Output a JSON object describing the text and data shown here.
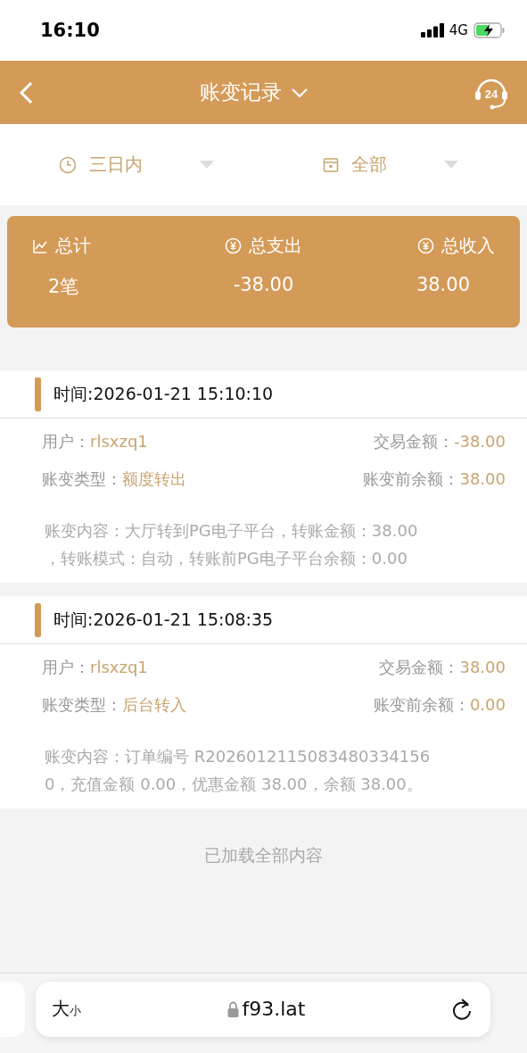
{
  "status_bar": {
    "time": "16:10",
    "network": "4G"
  },
  "header": {
    "title": "账变记录",
    "support_badge": "24"
  },
  "filters": [
    {
      "kind": "time",
      "label": "三日内"
    },
    {
      "kind": "type",
      "label": "全部"
    }
  ],
  "summary": [
    {
      "kind": "count",
      "label": "总计",
      "value": "2笔"
    },
    {
      "kind": "money",
      "label": "总支出",
      "value": "-38.00"
    },
    {
      "kind": "money",
      "label": "总收入",
      "value": "38.00"
    }
  ],
  "records": [
    {
      "time": "时间:2026-01-21 15:10:10",
      "user_label": "用户：",
      "user": "rlsxzq1",
      "amount_label": "交易金额：",
      "amount": "-38.00",
      "type_label": "账变类型：",
      "type": "额度转出",
      "balance_label": "账变前余额：",
      "balance": "38.00",
      "content_lines": [
        "账变内容：大厅转到PG电子平台，转账金额：38.00",
        "，转账模式：自动，转账前PG电子平台余额：0.00"
      ]
    },
    {
      "time": "时间:2026-01-21 15:08:35",
      "user_label": "用户：",
      "user": "rlsxzq1",
      "amount_label": "交易金额：",
      "amount": "38.00",
      "type_label": "账变类型：",
      "type": "后台转入",
      "balance_label": "账变前余额：",
      "balance": "0.00",
      "content_lines": [
        "账变内容：订单编号 R2026012115083480334156",
        "0，充值金额 0.00，优惠金额 38.00，余额 38.00。"
      ]
    }
  ],
  "footer_note": "已加载全部内容",
  "browser_bar": {
    "text_size": "大$_{小}$",
    "url": "f93.lat"
  }
}
